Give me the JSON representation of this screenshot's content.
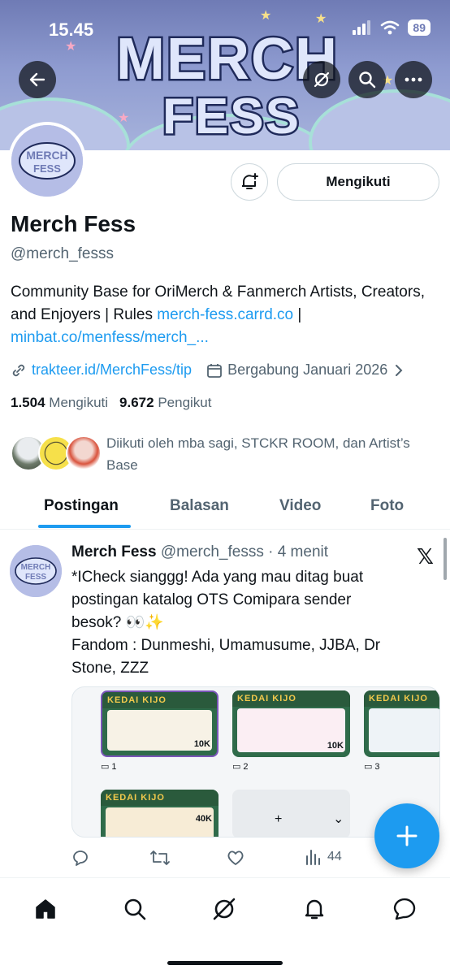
{
  "status": {
    "time": "15.45",
    "battery": "89"
  },
  "banner": {
    "logo_line1": "MERCH",
    "logo_line2": "FESS"
  },
  "profile": {
    "avatar_text": "MERCH FESS",
    "name": "Merch Fess",
    "handle": "@merch_fesss",
    "follow_label": "Mengikuti",
    "bio_text": "Community Base for OriMerch & Fanmerch Artists, Creators, and Enjoyers | Rules ",
    "bio_link1": "merch-fess.carrd.co",
    "bio_sep": " | ",
    "bio_link2": "minbat.co/menfess/merch_...",
    "website": "trakteer.id/MerchFess/tip",
    "joined": "Bergabung Januari 2026",
    "following_count": "1.504",
    "following_label": "Mengikuti",
    "followers_count": "9.672",
    "followers_label": "Pengikut",
    "followed_by": "Diikuti oleh mba sagi, STCKR ROOM, dan Artist’s Base"
  },
  "tabs": [
    {
      "label": "Postingan",
      "active": true
    },
    {
      "label": "Balasan",
      "active": false
    },
    {
      "label": "Video",
      "active": false
    },
    {
      "label": "Foto",
      "active": false
    }
  ],
  "tweet": {
    "name": "Merch Fess",
    "handle": "@merch_fesss",
    "time": "· 4 menit",
    "text_lines": [
      "*ICheck sianggg! Ada yang mau ditag buat",
      "postingan katalog OTS Comipara sender",
      "besok? 👀✨",
      "Fandom : Dunmeshi, Umamusume, JJBA, Dr",
      "Stone, ZZZ"
    ],
    "media": [
      {
        "brand": "KEDAI KIJO",
        "price": "10K",
        "caption": "1"
      },
      {
        "brand": "KEDAI KIJO",
        "price": "10K",
        "caption": "2"
      },
      {
        "brand": "KEDAI KIJO",
        "price": "",
        "caption": "3"
      },
      {
        "brand": "KEDAI KIJO",
        "price": "40K",
        "caption": ""
      }
    ],
    "add_plus": "+",
    "add_chevron": "⌄",
    "views": "44"
  },
  "colors": {
    "accent": "#1d9bf0",
    "text": "#0f1419",
    "secondary": "#536471",
    "banner": "#8e9bd0"
  },
  "icons": {
    "back": "arrow-left-icon",
    "grok": "grok-icon",
    "search": "search-icon",
    "more": "more-icon",
    "bell": "bell-plus-icon",
    "link": "link-icon",
    "calendar": "calendar-icon",
    "reply": "reply-icon",
    "retweet": "retweet-icon",
    "like": "heart-icon",
    "views": "views-icon",
    "compose": "plus-icon",
    "home": "home-icon",
    "explore": "search-icon",
    "notifications": "bell-icon",
    "messages": "chat-icon"
  }
}
